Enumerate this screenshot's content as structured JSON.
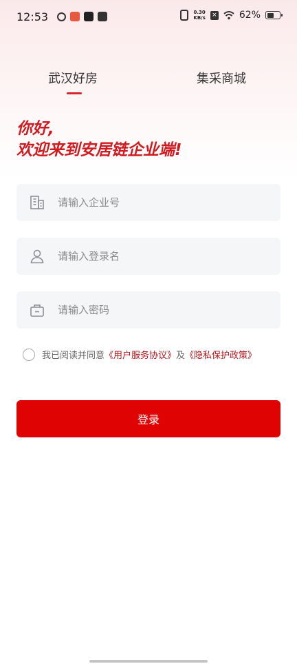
{
  "status_bar": {
    "time": "12:53",
    "net_speed_value": "0.30",
    "net_speed_unit": "KB/s",
    "battery_percent": "62%",
    "battery_level": 0.62,
    "icons": [
      "link-icon",
      "app-icon-red",
      "tiktok-icon",
      "mail-icon",
      "vibrate-icon",
      "sim-x-icon",
      "wifi-icon",
      "battery-icon"
    ]
  },
  "tabs": [
    {
      "label": "武汉好房",
      "active": true
    },
    {
      "label": "集采商城",
      "active": false
    }
  ],
  "greeting": {
    "line1": "你好,",
    "line2": "欢迎来到安居链企业端!"
  },
  "form": {
    "company_placeholder": "请输入企业号",
    "username_placeholder": "请输入登录名",
    "password_placeholder": "请输入密码"
  },
  "agreement": {
    "prefix": "我已阅读并同意",
    "user_agreement": "《用户服务协议》",
    "connector": "及",
    "privacy_policy": "《隐私保护政策》"
  },
  "login_button": "登录",
  "colors": {
    "brand_red": "#e00303",
    "greeting_red": "#d11a1f",
    "link_red": "#b4141a",
    "field_bg": "#f5f6f8"
  }
}
